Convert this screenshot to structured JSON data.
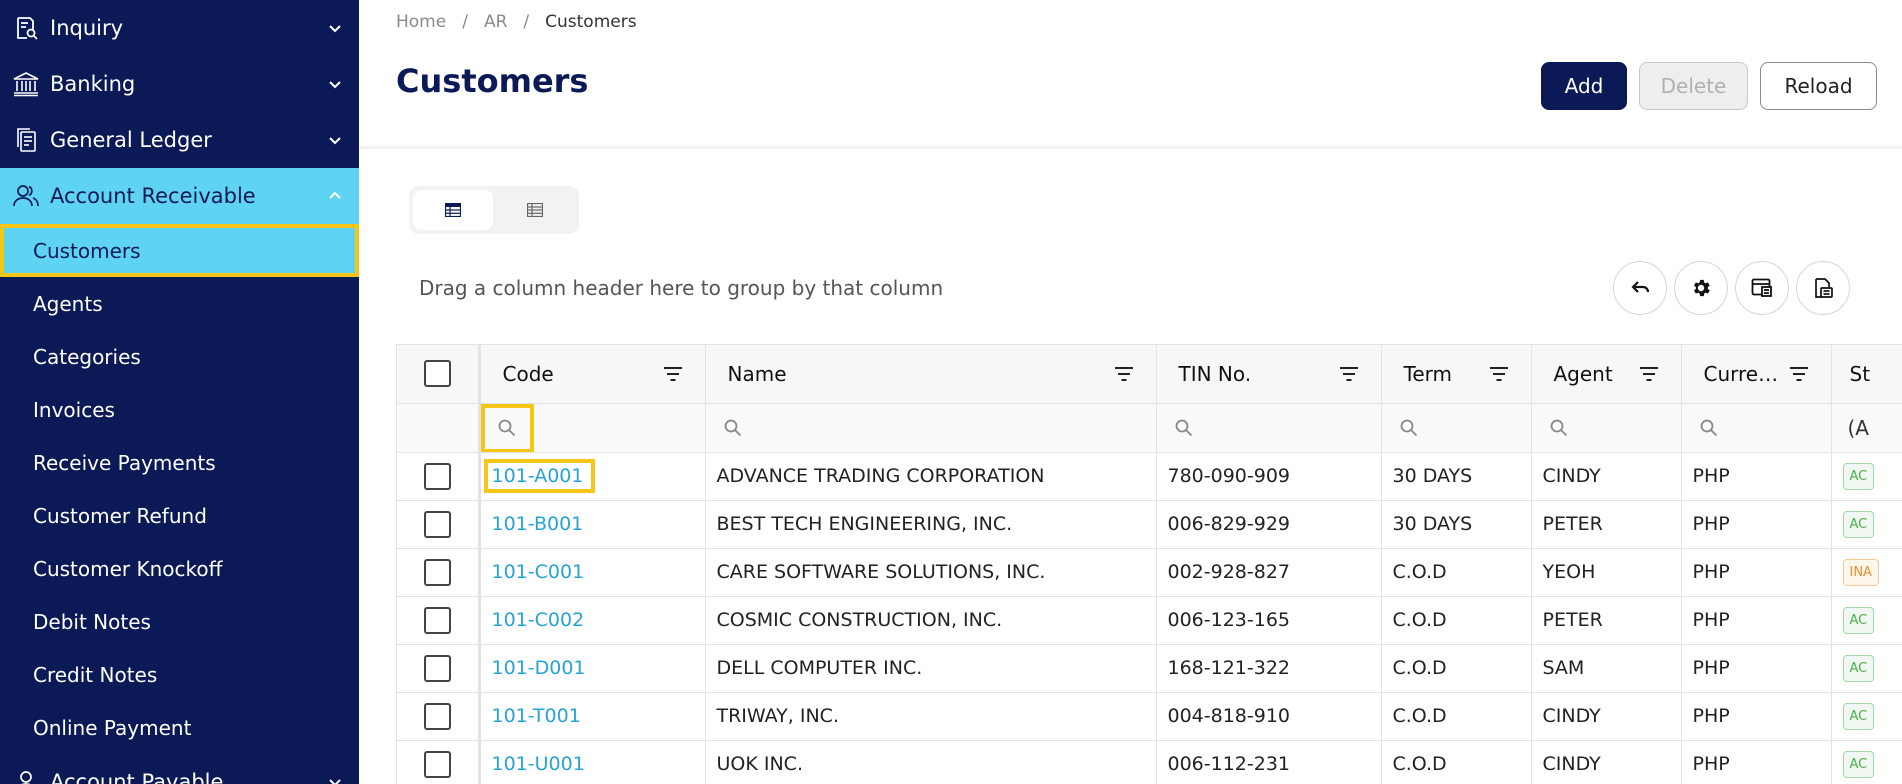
{
  "sidebar": {
    "groups": [
      {
        "label": "Inquiry",
        "icon": "inquiry-icon"
      },
      {
        "label": "Banking",
        "icon": "bank-icon"
      },
      {
        "label": "General Ledger",
        "icon": "ledger-icon"
      },
      {
        "label": "Account Receivable",
        "icon": "users-icon"
      }
    ],
    "items": [
      {
        "label": "Customers"
      },
      {
        "label": "Agents"
      },
      {
        "label": "Categories"
      },
      {
        "label": "Invoices"
      },
      {
        "label": "Receive Payments"
      },
      {
        "label": "Customer Refund"
      },
      {
        "label": "Customer Knockoff"
      },
      {
        "label": "Debit Notes"
      },
      {
        "label": "Credit Notes"
      },
      {
        "label": "Online Payment"
      }
    ],
    "next_group": {
      "label": "Account Payable",
      "icon": "user-icon"
    }
  },
  "breadcrumb": {
    "home": "Home",
    "ar": "AR",
    "current": "Customers",
    "separator": "/"
  },
  "page": {
    "title": "Customers"
  },
  "toolbar": {
    "add": "Add",
    "delete": "Delete",
    "reload": "Reload"
  },
  "grid_toolbar": {
    "group_hint": "Drag a column header here to group by that column",
    "icons": [
      "undo-icon",
      "settings-icon",
      "column-chooser-icon",
      "export-icon"
    ]
  },
  "table": {
    "columns": [
      "Code",
      "Name",
      "TIN No.",
      "Term",
      "Agent",
      "Curre…",
      "St"
    ],
    "status_filter_text": "(A",
    "rows": [
      {
        "code": "101-A001",
        "name": "ADVANCE TRADING CORPORATION",
        "tin": "780-090-909",
        "term": "30 DAYS",
        "agent": "CINDY",
        "currency": "PHP",
        "status": "AC"
      },
      {
        "code": "101-B001",
        "name": "BEST TECH ENGINEERING, INC.",
        "tin": "006-829-929",
        "term": "30 DAYS",
        "agent": "PETER",
        "currency": "PHP",
        "status": "AC"
      },
      {
        "code": "101-C001",
        "name": "CARE SOFTWARE SOLUTIONS, INC.",
        "tin": "002-928-827",
        "term": "C.O.D",
        "agent": "YEOH",
        "currency": "PHP",
        "status": "INA"
      },
      {
        "code": "101-C002",
        "name": "COSMIC CONSTRUCTION, INC.",
        "tin": "006-123-165",
        "term": "C.O.D",
        "agent": "PETER",
        "currency": "PHP",
        "status": "AC"
      },
      {
        "code": "101-D001",
        "name": "DELL COMPUTER INC.",
        "tin": "168-121-322",
        "term": "C.O.D",
        "agent": "SAM",
        "currency": "PHP",
        "status": "AC"
      },
      {
        "code": "101-T001",
        "name": "TRIWAY, INC.",
        "tin": "004-818-910",
        "term": "C.O.D",
        "agent": "CINDY",
        "currency": "PHP",
        "status": "AC"
      },
      {
        "code": "101-U001",
        "name": "UOK INC.",
        "tin": "006-112-231",
        "term": "C.O.D",
        "agent": "CINDY",
        "currency": "PHP",
        "status": "AC"
      }
    ]
  },
  "colors": {
    "sidebar_bg": "#0b1a57",
    "sidebar_active": "#5fd3f2",
    "highlight": "#f5c518",
    "link": "#29a3d6"
  }
}
